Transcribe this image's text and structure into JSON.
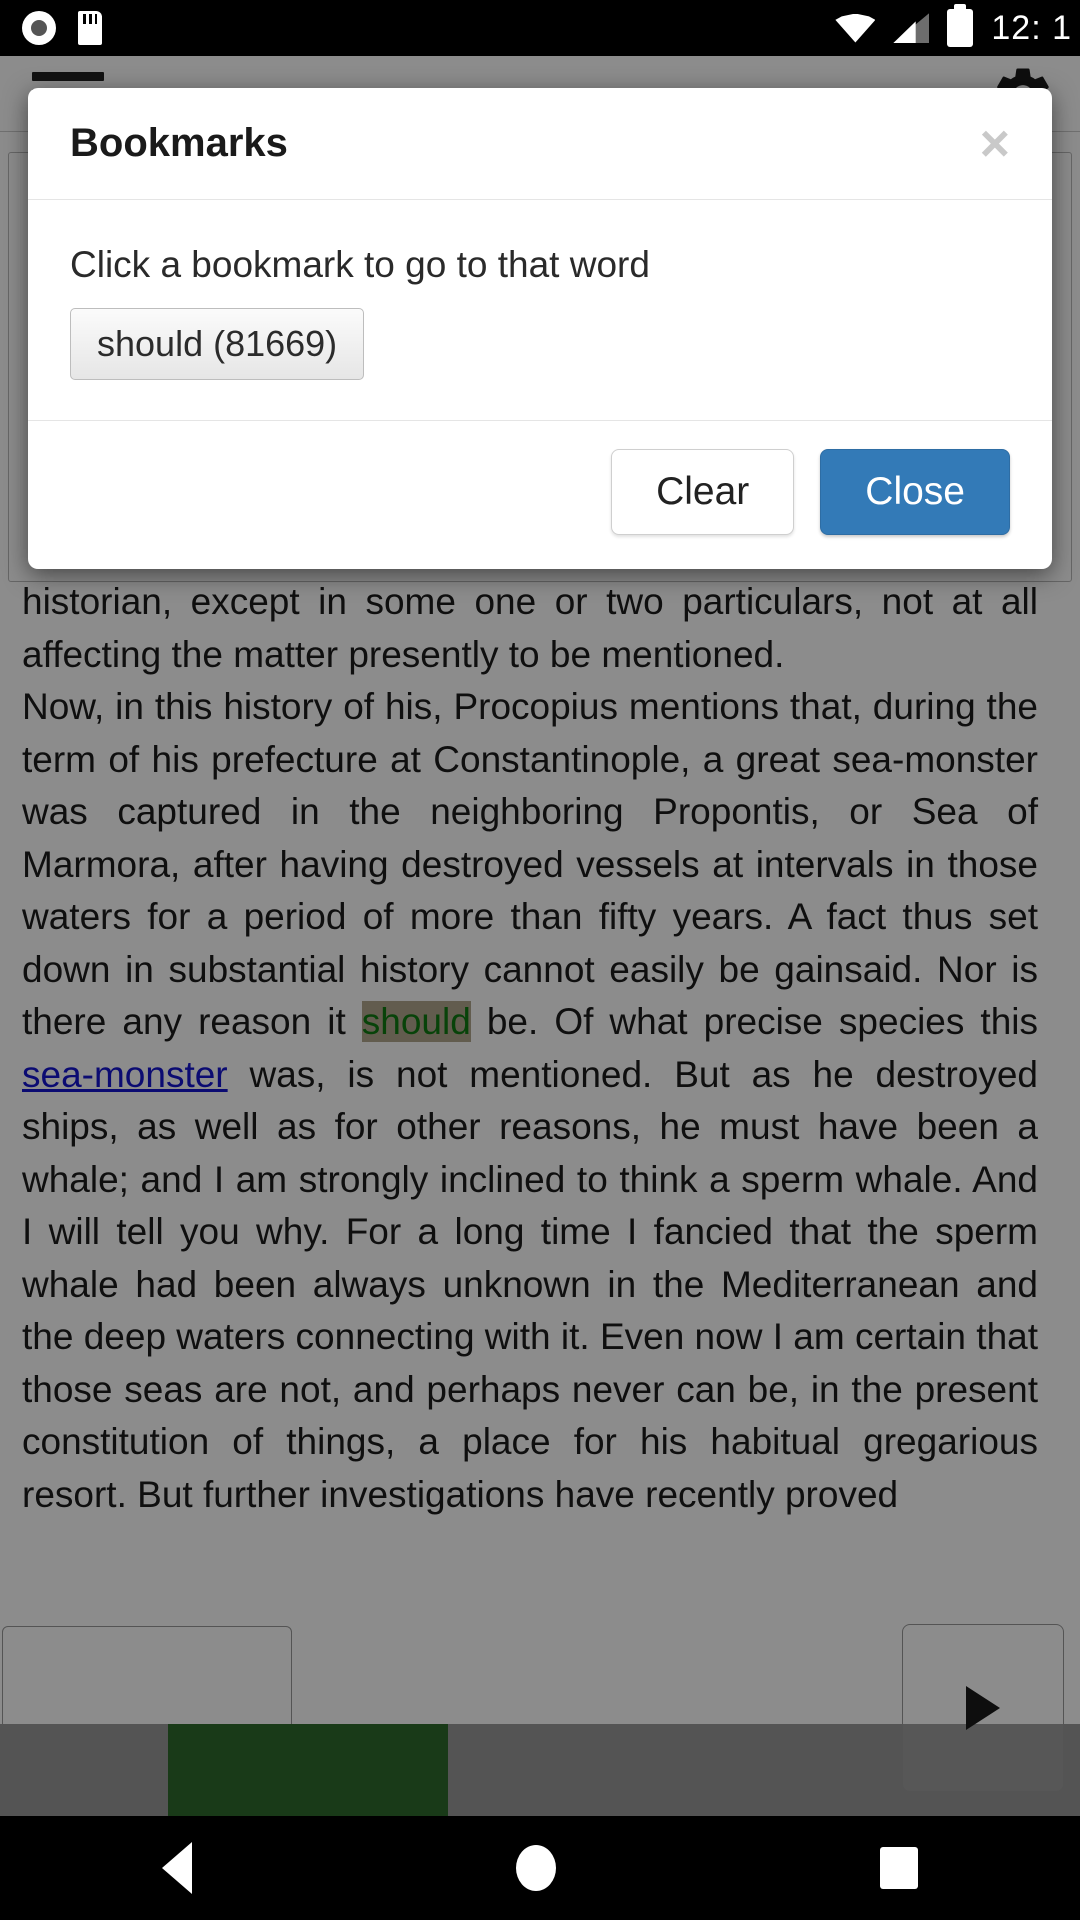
{
  "status_bar": {
    "time": "12: 1",
    "icons": [
      "record-icon",
      "sd-card-icon",
      "wifi-icon",
      "signal-icon",
      "battery-icon"
    ]
  },
  "app_bar": {
    "menu_icon": "hamburger-menu-icon",
    "settings_icon": "gear-icon"
  },
  "reader": {
    "paragraphs": [
      {
        "id": "p1",
        "runs": [
          {
            "type": "text",
            "text": "historian, except in some one or two particulars, not at all affecting the matter presently to be mentioned."
          }
        ]
      },
      {
        "id": "p2",
        "runs": [
          {
            "type": "text",
            "text": "Now, in this history of his, Procopius mentions that, during the term of his prefecture at Constantinople, a great sea-monster was captured in the neighboring Propontis, or Sea of Marmora, after having destroyed vessels at intervals in those waters for a period of more than fifty years. A fact thus set down in substantial history cannot easily be gainsaid. Nor is there any reason it "
          },
          {
            "type": "bookmark",
            "text": "should"
          },
          {
            "type": "text",
            "text": " be. Of what precise species this "
          },
          {
            "type": "link",
            "text": "sea-monster"
          },
          {
            "type": "text",
            "text": " was, is not mentioned. But as he destroyed ships, as well as for other reasons, he must have been a whale; and I am strongly inclined to think a sperm whale. And I will tell you why. For a long time I fancied that the sperm whale had been always unknown in the Mediterranean and the deep waters connecting with it. Even now I am certain that those seas are not, and perhaps never can be, in the present constitution of things, a place for his habitual gregarious resort. But further investigations have recently proved"
          }
        ]
      }
    ],
    "highlight_color": "#b3a88f",
    "bookmark_word_color": "#0f7a12",
    "link_color": "#1414cf"
  },
  "player": {
    "play_icon": "play-icon",
    "progress_color": "#2e6b2c"
  },
  "modal": {
    "title": "Bookmarks",
    "close_label": "×",
    "hint": "Click a bookmark to go to that word",
    "bookmarks": [
      {
        "label": "should (81669)"
      }
    ],
    "clear_label": "Clear",
    "close_button_label": "Close",
    "primary_color": "#337ab7"
  },
  "nav_bar": {
    "back": "back-nav-icon",
    "home": "home-nav-icon",
    "recents": "recents-nav-icon"
  }
}
